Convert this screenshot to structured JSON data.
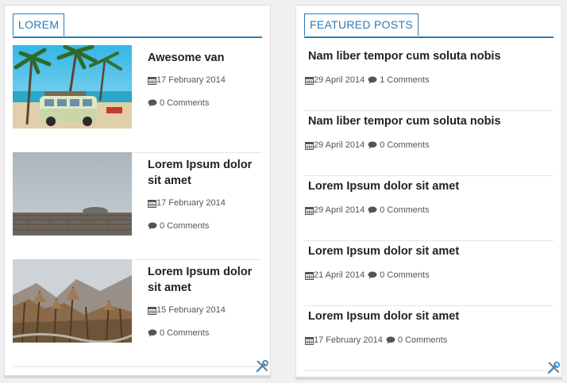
{
  "left_widget": {
    "title": "LOREM",
    "posts": [
      {
        "title_line1": "Awesome van",
        "title_line2": "",
        "date": "17 February 2014",
        "comments": "0 Comments"
      },
      {
        "title_line1": "Lorem Ipsum dolor",
        "title_line2": "sit amet",
        "date": "17 February 2014",
        "comments": "0 Comments"
      },
      {
        "title_line1": "Lorem Ipsum dolor",
        "title_line2": "sit amet",
        "date": "15 February 2014",
        "comments": "0 Comments"
      }
    ]
  },
  "right_widget": {
    "title": "FEATURED POSTS",
    "posts": [
      {
        "title": "Nam liber tempor cum soluta nobis",
        "date": "29 April 2014",
        "comments": "1 Comments"
      },
      {
        "title": "Nam liber tempor cum soluta nobis",
        "date": "29 April 2014",
        "comments": "0 Comments"
      },
      {
        "title": "Lorem Ipsum dolor sit amet",
        "date": "29 April 2014",
        "comments": "0 Comments"
      },
      {
        "title": "Lorem Ipsum dolor sit amet",
        "date": "21 April 2014",
        "comments": "0 Comments"
      },
      {
        "title": "Lorem Ipsum dolor sit amet",
        "date": "17 February 2014",
        "comments": "0 Comments"
      }
    ]
  },
  "icons": {
    "date": "calendar-icon",
    "comments": "comment-icon",
    "edit": "tools-icon"
  },
  "colors": {
    "accent": "#2f7ab2",
    "title_text": "#222222",
    "meta_text": "#555555"
  }
}
